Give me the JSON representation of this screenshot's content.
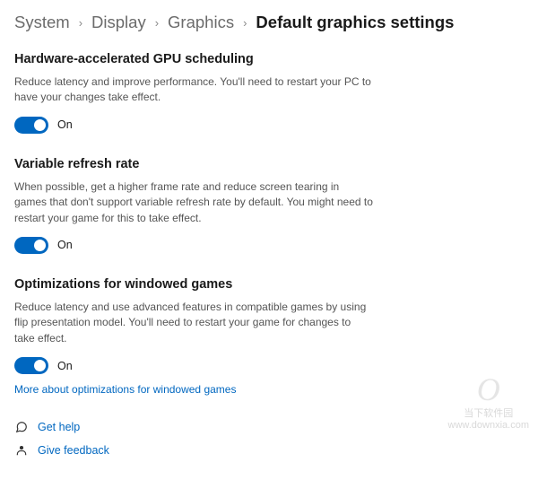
{
  "breadcrumb": {
    "items": [
      "System",
      "Display",
      "Graphics",
      "Default graphics settings"
    ]
  },
  "sections": {
    "gpu": {
      "title": "Hardware-accelerated GPU scheduling",
      "desc": "Reduce latency and improve performance. You'll need to restart your PC to have your changes take effect.",
      "toggle_state": "On"
    },
    "vrr": {
      "title": "Variable refresh rate",
      "desc": "When possible, get a higher frame rate and reduce screen tearing in games that don't support variable refresh rate by default. You might need to restart your game for this to take effect.",
      "toggle_state": "On"
    },
    "windowed": {
      "title": "Optimizations for windowed games",
      "desc": "Reduce latency and use advanced features in compatible games by using flip presentation model. You'll need to restart your game for changes to take effect.",
      "toggle_state": "On",
      "link": "More about optimizations for windowed games"
    }
  },
  "footer": {
    "help": "Get help",
    "feedback": "Give feedback"
  },
  "watermark": {
    "text1": "当下软件园",
    "text2": "www.downxia.com"
  }
}
